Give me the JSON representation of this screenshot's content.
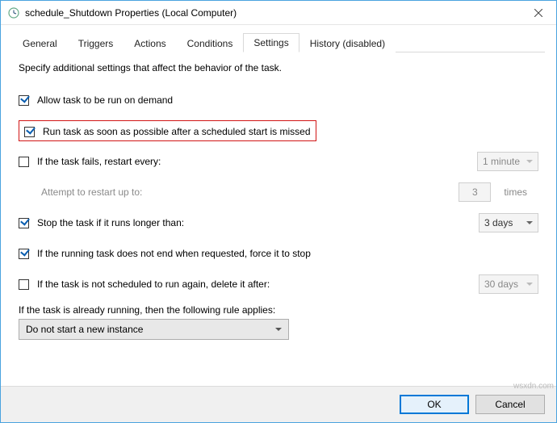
{
  "window": {
    "title": "schedule_Shutdown Properties (Local Computer)"
  },
  "tabs": {
    "general": "General",
    "triggers": "Triggers",
    "actions": "Actions",
    "conditions": "Conditions",
    "settings": "Settings",
    "history": "History (disabled)"
  },
  "settings": {
    "intro": "Specify additional settings that affect the behavior of the task.",
    "onDemand": {
      "label": "Allow task to be run on demand",
      "checked": true
    },
    "runAfterMissed": {
      "label": "Run task as soon as possible after a scheduled start is missed",
      "checked": true
    },
    "restartIfFails": {
      "label": "If the task fails, restart every:",
      "checked": false,
      "interval": "1 minute",
      "attemptsLabel": "Attempt to restart up to:",
      "attempts": "3",
      "timesSuffix": "times"
    },
    "stopIfLonger": {
      "label": "Stop the task if it runs longer than:",
      "checked": true,
      "value": "3 days"
    },
    "forceStop": {
      "label": "If the running task does not end when requested, force it to stop",
      "checked": true
    },
    "deleteAfter": {
      "label": "If the task is not scheduled to run again, delete it after:",
      "checked": false,
      "value": "30 days"
    },
    "alreadyRunningLabel": "If the task is already running, then the following rule applies:",
    "rule": "Do not start a new instance"
  },
  "buttons": {
    "ok": "OK",
    "cancel": "Cancel"
  },
  "watermark": "wsxdn.com"
}
